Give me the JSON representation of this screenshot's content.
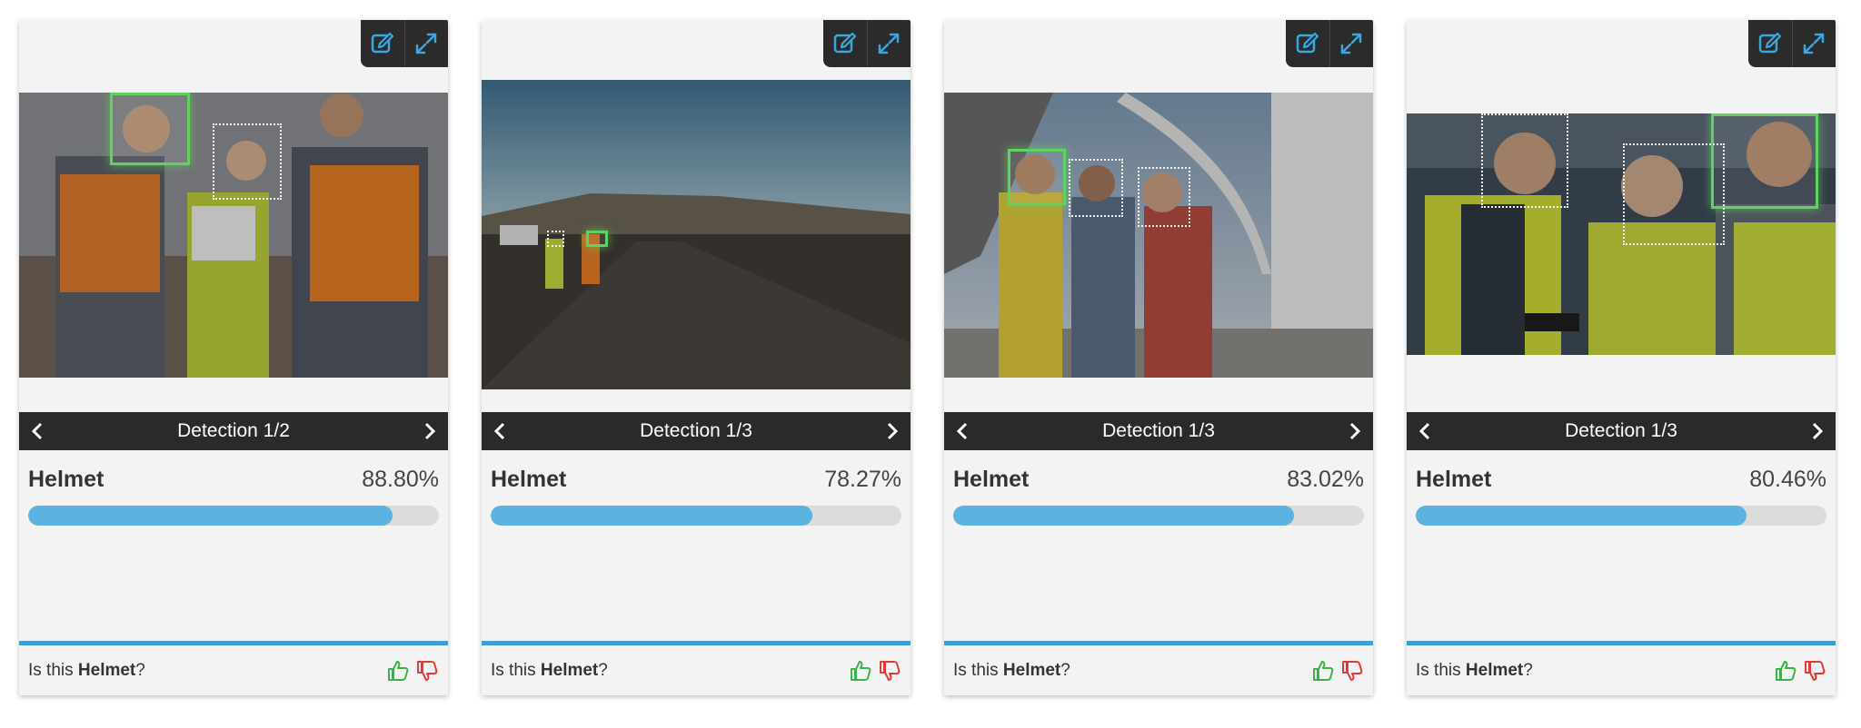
{
  "colors": {
    "accent_bar": "#5db3df",
    "divider": "#3d9fd6",
    "toolbar_bg": "#2b2b2b",
    "nav_bg": "#2a2a2a",
    "detection_active": "#5fd35f",
    "thumb_up": "#3bb24a",
    "thumb_down": "#e53935"
  },
  "icons": {
    "edit": "edit-icon",
    "expand": "expand-icon",
    "prev": "chevron-left-icon",
    "next": "chevron-right-icon",
    "thumb_up": "thumbs-up-icon",
    "thumb_down": "thumbs-down-icon"
  },
  "cards": [
    {
      "detection_title": "Detection 1/2",
      "label": "Helmet",
      "confidence_text": "88.80%",
      "confidence": 0.888,
      "question_prefix": "Is this ",
      "question_label": "Helmet",
      "question_suffix": "?"
    },
    {
      "detection_title": "Detection 1/3",
      "label": "Helmet",
      "confidence_text": "78.27%",
      "confidence": 0.7827,
      "question_prefix": "Is this ",
      "question_label": "Helmet",
      "question_suffix": "?"
    },
    {
      "detection_title": "Detection 1/3",
      "label": "Helmet",
      "confidence_text": "83.02%",
      "confidence": 0.8302,
      "question_prefix": "Is this ",
      "question_label": "Helmet",
      "question_suffix": "?"
    },
    {
      "detection_title": "Detection 1/3",
      "label": "Helmet",
      "confidence_text": "80.46%",
      "confidence": 0.8046,
      "question_prefix": "Is this ",
      "question_label": "Helmet",
      "question_suffix": "?"
    }
  ]
}
